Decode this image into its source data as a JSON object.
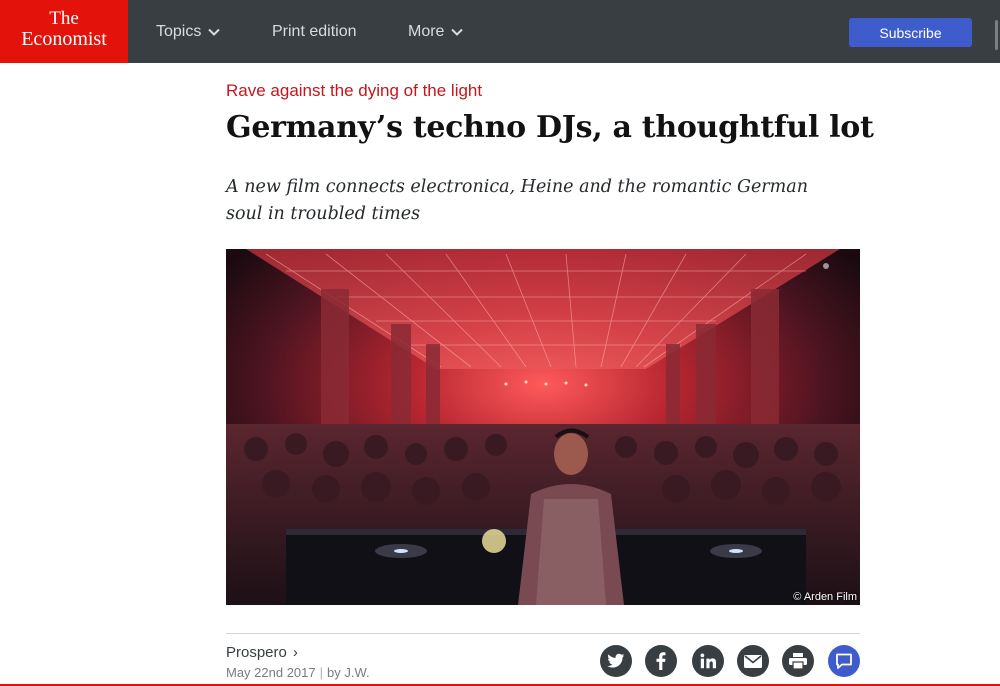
{
  "nav": {
    "logo_line1": "The",
    "logo_line2": "Economist",
    "topics_label": "Topics",
    "print_label": "Print edition",
    "more_label": "More",
    "subscribe_label": "Subscribe"
  },
  "article": {
    "flytitle": "Rave against the dying of the light",
    "headline": "Germany’s techno DJs, a thoughtful lot",
    "rubric": "A new film connects electronica, Heine and the romantic German soul in troubled times",
    "image_credit": "© Arden Film",
    "section": "Prospero",
    "date": "May 22nd 2017",
    "byline": "by J.W."
  },
  "share_icons": [
    "twitter-icon",
    "facebook-icon",
    "linkedin-icon",
    "email-icon",
    "print-icon",
    "comment-icon"
  ],
  "colors": {
    "brand_red": "#e3120b",
    "nav_bg": "#383e42",
    "subscribe_blue": "#3f5ccc",
    "flytitle_red": "#c4161c"
  }
}
